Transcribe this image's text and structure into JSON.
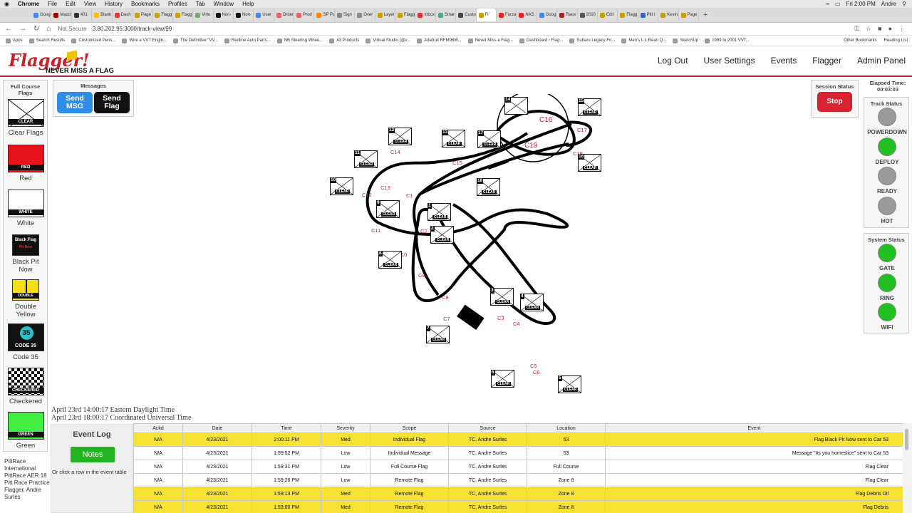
{
  "mac": {
    "apple": "",
    "app": "Chrome",
    "menus": [
      "File",
      "Edit",
      "View",
      "History",
      "Bookmarks",
      "Profiles",
      "Tab",
      "Window",
      "Help"
    ],
    "clock": "Fri 2:00 PM",
    "user": "Andre"
  },
  "tabs": [
    {
      "label": "Goog",
      "color": "#4285f4"
    },
    {
      "label": "Mazd",
      "color": "#a00"
    },
    {
      "label": "401",
      "color": "#333"
    },
    {
      "label": "Blank",
      "color": "#f2c200"
    },
    {
      "label": "Dash",
      "color": "#e33"
    },
    {
      "label": "Page",
      "color": "#c8a000"
    },
    {
      "label": "Flagg",
      "color": "#c8a000"
    },
    {
      "label": "Flagg",
      "color": "#c8a000"
    },
    {
      "label": "Virtu",
      "color": "#7a7"
    },
    {
      "label": "Non-",
      "color": "#111"
    },
    {
      "label": "Non-",
      "color": "#111"
    },
    {
      "label": "User",
      "color": "#4285f4"
    },
    {
      "label": "Order",
      "color": "#d66"
    },
    {
      "label": "Prod",
      "color": "#d66"
    },
    {
      "label": "SP Pa",
      "color": "#f80"
    },
    {
      "label": "Sign",
      "color": "#888"
    },
    {
      "label": "Over",
      "color": "#888"
    },
    {
      "label": "Layer",
      "color": "#c8a000"
    },
    {
      "label": "Flagg",
      "color": "#c8a000"
    },
    {
      "label": "Inbox",
      "color": "#d33"
    },
    {
      "label": "Smar",
      "color": "#4a8"
    },
    {
      "label": "Custo",
      "color": "#444"
    },
    {
      "label": "Fl",
      "color": "#c8a000",
      "active": true
    },
    {
      "label": "Forza",
      "color": "#e22"
    },
    {
      "label": "NAS",
      "color": "#e22"
    },
    {
      "label": "Goog",
      "color": "#4285f4"
    },
    {
      "label": "Race",
      "color": "#a22"
    },
    {
      "label": "2010",
      "color": "#555"
    },
    {
      "label": "Edit",
      "color": "#c8a000"
    },
    {
      "label": "Flagg",
      "color": "#c8a000"
    },
    {
      "label": "Pitt I",
      "color": "#36c"
    },
    {
      "label": "Kevin",
      "color": "#c8a000"
    },
    {
      "label": "Page",
      "color": "#c8a000"
    }
  ],
  "address": {
    "security": "Not Secure",
    "url": "3.80.202.95:3000/track-view/99"
  },
  "bookmarks": {
    "items": [
      "Apps",
      "Search Results",
      "Customized Pens...",
      "Wire a VVT Engin...",
      "The Definitive \"VV...",
      "Redline Auto Parts...",
      "NB Steering Whee...",
      "All Products",
      "Virtual Studio (@v...",
      "Adafruit RFM96W...",
      "Never Miss a Flag...",
      "Dashboard ‹ Flag...",
      "Subaru Legacy Fo...",
      "Men's L.L.Bean Q...",
      "SketchUp",
      "1999 to 2001 VVT..."
    ],
    "other": "Other Bookmarks",
    "reading": "Reading List"
  },
  "logo": {
    "word": "Flagger!",
    "tagline": "NEVER MISS A FLAG"
  },
  "nav": [
    "Log Out",
    "User Settings",
    "Events",
    "Flagger",
    "Admin Panel"
  ],
  "full_course": {
    "header": "Full Course Flags",
    "flags": [
      {
        "name": "clear",
        "label": "CLEAR",
        "caption": "Clear Flags"
      },
      {
        "name": "red",
        "label": "RED",
        "caption": "Red"
      },
      {
        "name": "white",
        "label": "WHITE",
        "caption": "White"
      },
      {
        "name": "black-pit",
        "label": "Black Flag",
        "sub": "Pit Now",
        "caption": "Black Pit Now"
      },
      {
        "name": "double-yellow",
        "label": "DOUBLE",
        "caption": "Double Yellow"
      },
      {
        "name": "code35",
        "label": "CODE 35",
        "num": "35",
        "caption": "Code 35"
      },
      {
        "name": "checkered",
        "label": "CHECKERED",
        "caption": "Checkered"
      },
      {
        "name": "green",
        "label": "GREEN",
        "caption": "Green"
      }
    ]
  },
  "messages": {
    "header": "Messages",
    "send_msg": "Send MSG",
    "send_flag": "Send Flag"
  },
  "session": {
    "header": "Session Status",
    "stop": "Stop"
  },
  "elapsed": {
    "label": "Elapsed Time:",
    "value": "00:03:03"
  },
  "track_status": {
    "header": "Track Status",
    "lights": [
      {
        "label": "POWERDOWN",
        "color": "#9a9a9a"
      },
      {
        "label": "DEPLOY",
        "color": "#21c021"
      },
      {
        "label": "READY",
        "color": "#9a9a9a"
      },
      {
        "label": "HOT",
        "color": "#9a9a9a"
      }
    ]
  },
  "system_status": {
    "header": "System Status",
    "lights": [
      {
        "label": "GATE",
        "color": "#21c021"
      },
      {
        "label": "RING",
        "color": "#21c021"
      },
      {
        "label": "WIFI",
        "color": "#21c021"
      }
    ]
  },
  "map": {
    "markers": [
      {
        "num": "1",
        "label": "CLEAR"
      },
      {
        "num": "2",
        "label": "CLEAR"
      },
      {
        "num": "3",
        "label": "CLEAR"
      },
      {
        "num": "4",
        "label": "CLEAR"
      },
      {
        "num": "5",
        "label": "CLEAR"
      },
      {
        "num": "6",
        "label": "CLEAR"
      },
      {
        "num": "7",
        "label": "CLEAR"
      },
      {
        "num": "8",
        "label": "CLEAR"
      },
      {
        "num": "9",
        "label": "CLEAR"
      },
      {
        "num": "10",
        "label": "CLEAR"
      },
      {
        "num": "11",
        "label": "CLEAR"
      },
      {
        "num": "12",
        "label": "CLEAR"
      },
      {
        "num": "13",
        "label": "CLEAR"
      },
      {
        "num": "14",
        "label": ""
      },
      {
        "num": "15",
        "label": "CLEAR"
      },
      {
        "num": "16",
        "label": "CLEAR"
      },
      {
        "num": "17",
        "label": "CLEAR"
      },
      {
        "num": "18",
        "label": "CLEAR"
      }
    ],
    "corners": [
      "C1",
      "C2",
      "C3",
      "C4",
      "C5",
      "C6",
      "C7",
      "C8",
      "C9",
      "10",
      "C11",
      "C12",
      "C13",
      "C14",
      "C15",
      "C16",
      "C17",
      "C18",
      "C19"
    ]
  },
  "times": {
    "local": "April 23rd 14:00:17 Eastern Daylight Time",
    "utc": "April 23rd 18:00:17 Coordinated Universal Time"
  },
  "event_log": {
    "title": "Event Log",
    "notes": "Notes",
    "hint": "Or click a row in the event table"
  },
  "table": {
    "columns": [
      "Ackd",
      "Date",
      "Time",
      "Severity",
      "Scope",
      "Source",
      "Location",
      "Event"
    ],
    "rows": [
      {
        "hi": true,
        "cells": [
          "N/A",
          "4/23/2021",
          "2:00:11 PM",
          "Med",
          "Individual Flag",
          "TC, Andre Surles",
          "53",
          "Flag Black Pit Now sent to Car 53"
        ]
      },
      {
        "hi": false,
        "cells": [
          "N/A",
          "4/23/2021",
          "1:59:52 PM",
          "Low",
          "Individual Message",
          "TC, Andre Surles",
          "53",
          "Message \"Its you homeslice\" sent to Car 53"
        ]
      },
      {
        "hi": false,
        "cells": [
          "N/A",
          "4/23/2021",
          "1:59:31 PM",
          "Low",
          "Full Course Flag",
          "TC, Andre Surles",
          "Full Course",
          "Flag Clear"
        ]
      },
      {
        "hi": false,
        "cells": [
          "N/A",
          "4/23/2021",
          "1:59:26 PM",
          "Low",
          "Remote Flag",
          "TC, Andre Surles",
          "Zone 8",
          "Flag Clear"
        ]
      },
      {
        "hi": true,
        "cells": [
          "N/A",
          "4/23/2021",
          "1:59:13 PM",
          "Med",
          "Remote Flag",
          "TC, Andre Surles",
          "Zone 8",
          "Flag Debris Oil"
        ]
      },
      {
        "hi": true,
        "cells": [
          "N/A",
          "4/23/2021",
          "1:59:00 PM",
          "Med",
          "Remote Flag",
          "TC, Andre Surles",
          "Zone 8",
          "Flag Debris"
        ]
      }
    ]
  },
  "footer_text": "PittRace International PittRace AER 18 Pitt Race Practice Flagger, Andre Surles",
  "colors": {
    "brand": "#c8202a",
    "accent_blue": "#2f8ee8",
    "stop": "#d92331",
    "highlight_row": "#f7e234",
    "notes_green": "#21b321"
  }
}
